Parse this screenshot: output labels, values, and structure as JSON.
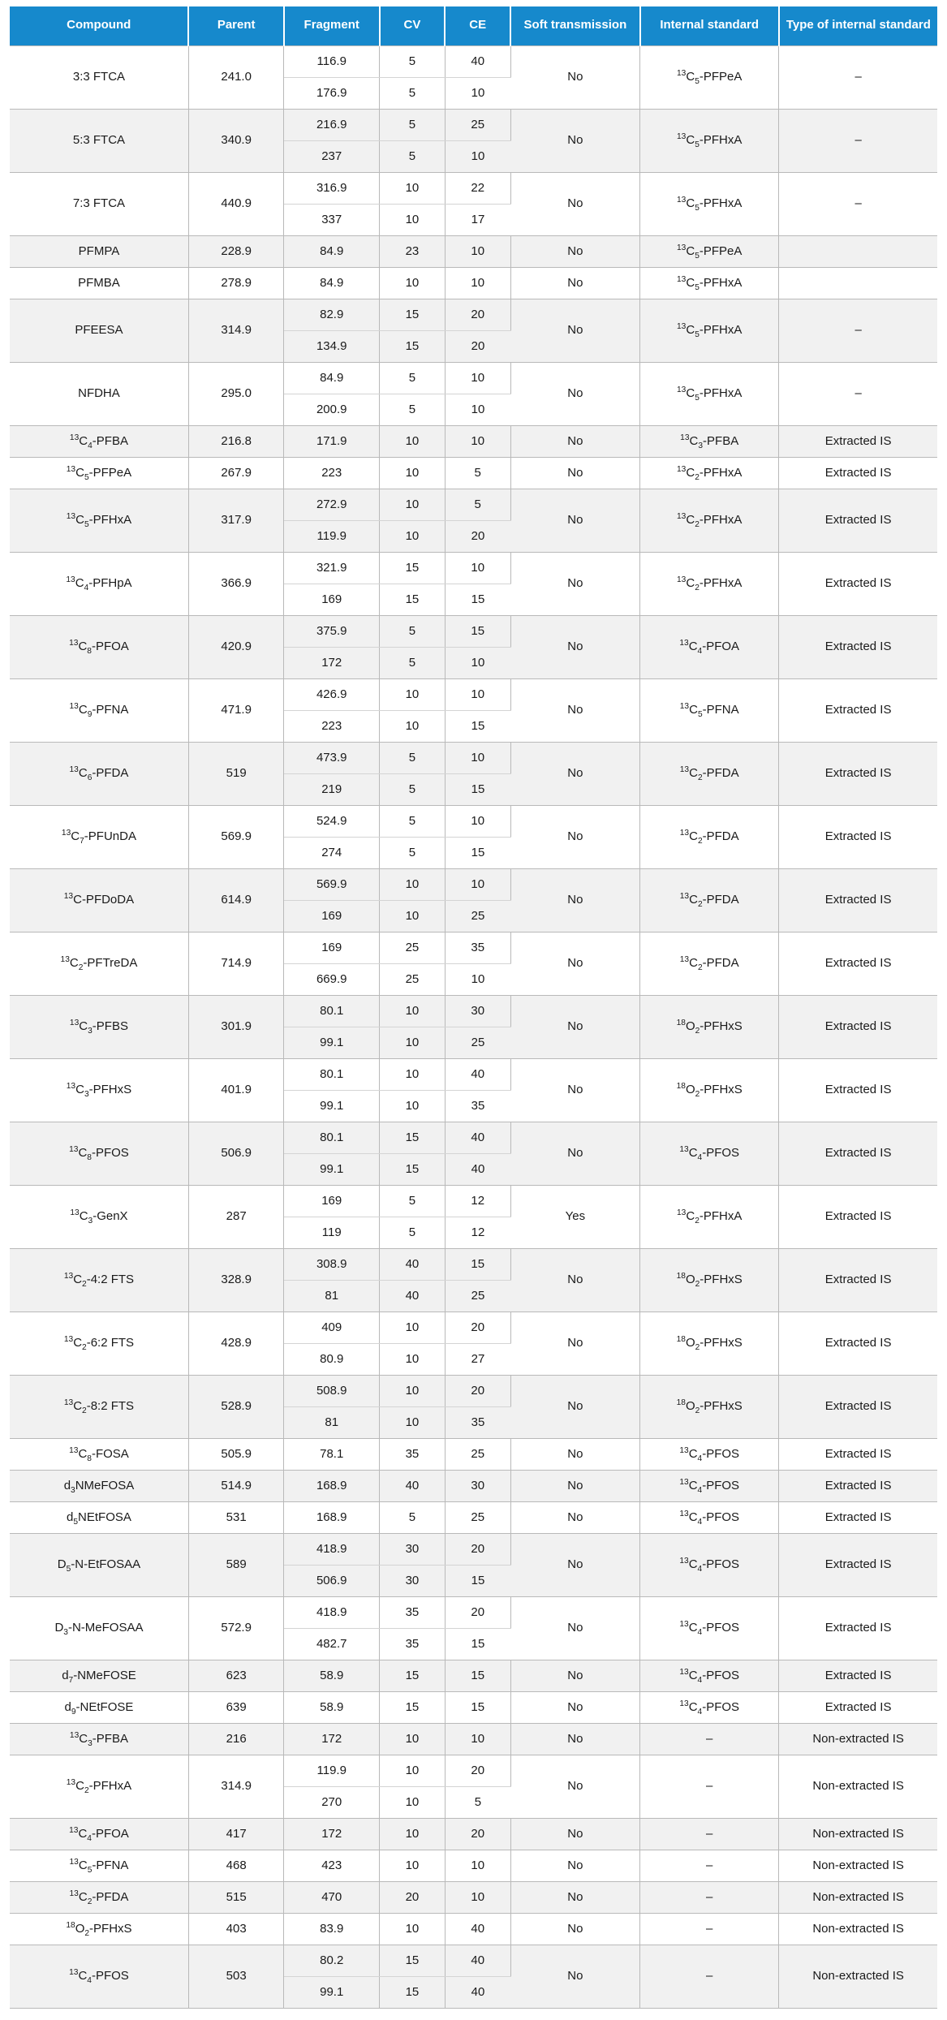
{
  "table": {
    "name": "MRM transition parameters table",
    "header_bg": "#1689cc",
    "header_text_color": "#ffffff",
    "stripe_color": "#f1f1f1",
    "columns": [
      {
        "key": "compound",
        "label": "Compound"
      },
      {
        "key": "parent",
        "label": "Parent"
      },
      {
        "key": "fragment",
        "label": "Fragment"
      },
      {
        "key": "cv",
        "label": "CV"
      },
      {
        "key": "ce",
        "label": "CE"
      },
      {
        "key": "soft",
        "label": "Soft transmission"
      },
      {
        "key": "istd",
        "label": "Internal standard"
      },
      {
        "key": "type",
        "label": "Type of internal standard"
      }
    ],
    "rows": [
      {
        "compound": "3:3 FTCA",
        "parent": "241.0",
        "transitions": [
          {
            "fragment": "116.9",
            "cv": "5",
            "ce": "40"
          },
          {
            "fragment": "176.9",
            "cv": "5",
            "ce": "10"
          }
        ],
        "soft": "No",
        "istd": "13C5-PFPeA",
        "type": "–"
      },
      {
        "compound": "5:3 FTCA",
        "parent": "340.9",
        "transitions": [
          {
            "fragment": "216.9",
            "cv": "5",
            "ce": "25"
          },
          {
            "fragment": "237",
            "cv": "5",
            "ce": "10"
          }
        ],
        "soft": "No",
        "istd": "13C5-PFHxA",
        "type": "–"
      },
      {
        "compound": "7:3 FTCA",
        "parent": "440.9",
        "transitions": [
          {
            "fragment": "316.9",
            "cv": "10",
            "ce": "22"
          },
          {
            "fragment": "337",
            "cv": "10",
            "ce": "17"
          }
        ],
        "soft": "No",
        "istd": "13C5-PFHxA",
        "type": "–"
      },
      {
        "compound": "PFMPA",
        "parent": "228.9",
        "transitions": [
          {
            "fragment": "84.9",
            "cv": "23",
            "ce": "10"
          }
        ],
        "soft": "No",
        "istd": "13C5-PFPeA",
        "type": ""
      },
      {
        "compound": "PFMBA",
        "parent": "278.9",
        "transitions": [
          {
            "fragment": "84.9",
            "cv": "10",
            "ce": "10"
          }
        ],
        "soft": "No",
        "istd": "13C5-PFHxA",
        "type": ""
      },
      {
        "compound": "PFEESA",
        "parent": "314.9",
        "transitions": [
          {
            "fragment": "82.9",
            "cv": "15",
            "ce": "20"
          },
          {
            "fragment": "134.9",
            "cv": "15",
            "ce": "20"
          }
        ],
        "soft": "No",
        "istd": "13C5-PFHxA",
        "type": "–"
      },
      {
        "compound": "NFDHA",
        "parent": "295.0",
        "transitions": [
          {
            "fragment": "84.9",
            "cv": "5",
            "ce": "10"
          },
          {
            "fragment": "200.9",
            "cv": "5",
            "ce": "10"
          }
        ],
        "soft": "No",
        "istd": "13C5-PFHxA",
        "type": "–"
      },
      {
        "compound": "13C4-PFBA",
        "parent": "216.8",
        "transitions": [
          {
            "fragment": "171.9",
            "cv": "10",
            "ce": "10"
          }
        ],
        "soft": "No",
        "istd": "13C3-PFBA",
        "type": "Extracted IS"
      },
      {
        "compound": "13C5-PFPeA",
        "parent": "267.9",
        "transitions": [
          {
            "fragment": "223",
            "cv": "10",
            "ce": "5"
          }
        ],
        "soft": "No",
        "istd": "13C2-PFHxA",
        "type": "Extracted IS"
      },
      {
        "compound": "13C5-PFHxA",
        "parent": "317.9",
        "transitions": [
          {
            "fragment": "272.9",
            "cv": "10",
            "ce": "5"
          },
          {
            "fragment": "119.9",
            "cv": "10",
            "ce": "20"
          }
        ],
        "soft": "No",
        "istd": "13C2-PFHxA",
        "type": "Extracted IS"
      },
      {
        "compound": "13C4-PFHpA",
        "parent": "366.9",
        "transitions": [
          {
            "fragment": "321.9",
            "cv": "15",
            "ce": "10"
          },
          {
            "fragment": "169",
            "cv": "15",
            "ce": "15"
          }
        ],
        "soft": "No",
        "istd": "13C2-PFHxA",
        "type": "Extracted IS"
      },
      {
        "compound": "13C8-PFOA",
        "parent": "420.9",
        "transitions": [
          {
            "fragment": "375.9",
            "cv": "5",
            "ce": "15"
          },
          {
            "fragment": "172",
            "cv": "5",
            "ce": "10"
          }
        ],
        "soft": "No",
        "istd": "13C4-PFOA",
        "type": "Extracted IS"
      },
      {
        "compound": "13C9-PFNA",
        "parent": "471.9",
        "transitions": [
          {
            "fragment": "426.9",
            "cv": "10",
            "ce": "10"
          },
          {
            "fragment": "223",
            "cv": "10",
            "ce": "15"
          }
        ],
        "soft": "No",
        "istd": "13C5-PFNA",
        "type": "Extracted IS"
      },
      {
        "compound": "13C6-PFDA",
        "parent": "519",
        "transitions": [
          {
            "fragment": "473.9",
            "cv": "5",
            "ce": "10"
          },
          {
            "fragment": "219",
            "cv": "5",
            "ce": "15"
          }
        ],
        "soft": "No",
        "istd": "13C2-PFDA",
        "type": "Extracted IS"
      },
      {
        "compound": "13C7-PFUnDA",
        "parent": "569.9",
        "transitions": [
          {
            "fragment": "524.9",
            "cv": "5",
            "ce": "10"
          },
          {
            "fragment": "274",
            "cv": "5",
            "ce": "15"
          }
        ],
        "soft": "No",
        "istd": "13C2-PFDA",
        "type": "Extracted IS"
      },
      {
        "compound": "13C-PFDoDA",
        "parent": "614.9",
        "transitions": [
          {
            "fragment": "569.9",
            "cv": "10",
            "ce": "10"
          },
          {
            "fragment": "169",
            "cv": "10",
            "ce": "25"
          }
        ],
        "soft": "No",
        "istd": "13C2-PFDA",
        "type": "Extracted IS"
      },
      {
        "compound": "13C2-PFTreDA",
        "parent": "714.9",
        "transitions": [
          {
            "fragment": "169",
            "cv": "25",
            "ce": "35"
          },
          {
            "fragment": "669.9",
            "cv": "25",
            "ce": "10"
          }
        ],
        "soft": "No",
        "istd": "13C2-PFDA",
        "type": "Extracted IS"
      },
      {
        "compound": "13C3-PFBS",
        "parent": "301.9",
        "transitions": [
          {
            "fragment": "80.1",
            "cv": "10",
            "ce": "30"
          },
          {
            "fragment": "99.1",
            "cv": "10",
            "ce": "25"
          }
        ],
        "soft": "No",
        "istd": "18O2-PFHxS",
        "type": "Extracted IS"
      },
      {
        "compound": "13C3-PFHxS",
        "parent": "401.9",
        "transitions": [
          {
            "fragment": "80.1",
            "cv": "10",
            "ce": "40"
          },
          {
            "fragment": "99.1",
            "cv": "10",
            "ce": "35"
          }
        ],
        "soft": "No",
        "istd": "18O2-PFHxS",
        "type": "Extracted IS"
      },
      {
        "compound": "13C8-PFOS",
        "parent": "506.9",
        "transitions": [
          {
            "fragment": "80.1",
            "cv": "15",
            "ce": "40"
          },
          {
            "fragment": "99.1",
            "cv": "15",
            "ce": "40"
          }
        ],
        "soft": "No",
        "istd": "13C4-PFOS",
        "type": "Extracted IS"
      },
      {
        "compound": "13C3-GenX",
        "parent": "287",
        "transitions": [
          {
            "fragment": "169",
            "cv": "5",
            "ce": "12"
          },
          {
            "fragment": "119",
            "cv": "5",
            "ce": "12"
          }
        ],
        "soft": "Yes",
        "istd": "13C2-PFHxA",
        "type": "Extracted IS"
      },
      {
        "compound": "13C2-4:2 FTS",
        "parent": "328.9",
        "transitions": [
          {
            "fragment": "308.9",
            "cv": "40",
            "ce": "15"
          },
          {
            "fragment": "81",
            "cv": "40",
            "ce": "25"
          }
        ],
        "soft": "No",
        "istd": "18O2-PFHxS",
        "type": "Extracted IS"
      },
      {
        "compound": "13C2-6:2 FTS",
        "parent": "428.9",
        "transitions": [
          {
            "fragment": "409",
            "cv": "10",
            "ce": "20"
          },
          {
            "fragment": "80.9",
            "cv": "10",
            "ce": "27"
          }
        ],
        "soft": "No",
        "istd": "18O2-PFHxS",
        "type": "Extracted IS"
      },
      {
        "compound": "13C2-8:2 FTS",
        "parent": "528.9",
        "transitions": [
          {
            "fragment": "508.9",
            "cv": "10",
            "ce": "20"
          },
          {
            "fragment": "81",
            "cv": "10",
            "ce": "35"
          }
        ],
        "soft": "No",
        "istd": "18O2-PFHxS",
        "type": "Extracted IS"
      },
      {
        "compound": "13C8-FOSA",
        "parent": "505.9",
        "transitions": [
          {
            "fragment": "78.1",
            "cv": "35",
            "ce": "25"
          }
        ],
        "soft": "No",
        "istd": "13C4-PFOS",
        "type": "Extracted IS"
      },
      {
        "compound": "d3NMeFOSA",
        "parent": "514.9",
        "transitions": [
          {
            "fragment": "168.9",
            "cv": "40",
            "ce": "30"
          }
        ],
        "soft": "No",
        "istd": "13C4-PFOS",
        "type": "Extracted IS"
      },
      {
        "compound": "d5NEtFOSA",
        "parent": "531",
        "transitions": [
          {
            "fragment": "168.9",
            "cv": "5",
            "ce": "25"
          }
        ],
        "soft": "No",
        "istd": "13C4-PFOS",
        "type": "Extracted IS"
      },
      {
        "compound": "D5-N-EtFOSAA",
        "parent": "589",
        "transitions": [
          {
            "fragment": "418.9",
            "cv": "30",
            "ce": "20"
          },
          {
            "fragment": "506.9",
            "cv": "30",
            "ce": "15"
          }
        ],
        "soft": "No",
        "istd": "13C4-PFOS",
        "type": "Extracted IS"
      },
      {
        "compound": "D3-N-MeFOSAA",
        "parent": "572.9",
        "transitions": [
          {
            "fragment": "418.9",
            "cv": "35",
            "ce": "20"
          },
          {
            "fragment": "482.7",
            "cv": "35",
            "ce": "15"
          }
        ],
        "soft": "No",
        "istd": "13C4-PFOS",
        "type": "Extracted IS"
      },
      {
        "compound": "d7-NMeFOSE",
        "parent": "623",
        "transitions": [
          {
            "fragment": "58.9",
            "cv": "15",
            "ce": "15"
          }
        ],
        "soft": "No",
        "istd": "13C4-PFOS",
        "type": "Extracted IS"
      },
      {
        "compound": "d9-NEtFOSE",
        "parent": "639",
        "transitions": [
          {
            "fragment": "58.9",
            "cv": "15",
            "ce": "15"
          }
        ],
        "soft": "No",
        "istd": "13C4-PFOS",
        "type": "Extracted IS"
      },
      {
        "compound": "13C3-PFBA",
        "parent": "216",
        "transitions": [
          {
            "fragment": "172",
            "cv": "10",
            "ce": "10"
          }
        ],
        "soft": "No",
        "istd": "–",
        "type": "Non-extracted IS"
      },
      {
        "compound": "13C2-PFHxA",
        "parent": "314.9",
        "transitions": [
          {
            "fragment": "119.9",
            "cv": "10",
            "ce": "20"
          },
          {
            "fragment": "270",
            "cv": "10",
            "ce": "5"
          }
        ],
        "soft": "No",
        "istd": "–",
        "type": "Non-extracted IS"
      },
      {
        "compound": "13C4-PFOA",
        "parent": "417",
        "transitions": [
          {
            "fragment": "172",
            "cv": "10",
            "ce": "20"
          }
        ],
        "soft": "No",
        "istd": "–",
        "type": "Non-extracted IS"
      },
      {
        "compound": "13C5-PFNA",
        "parent": "468",
        "transitions": [
          {
            "fragment": "423",
            "cv": "10",
            "ce": "10"
          }
        ],
        "soft": "No",
        "istd": "–",
        "type": "Non-extracted IS"
      },
      {
        "compound": "13C2-PFDA",
        "parent": "515",
        "transitions": [
          {
            "fragment": "470",
            "cv": "20",
            "ce": "10"
          }
        ],
        "soft": "No",
        "istd": "–",
        "type": "Non-extracted IS"
      },
      {
        "compound": "18O2-PFHxS",
        "parent": "403",
        "transitions": [
          {
            "fragment": "83.9",
            "cv": "10",
            "ce": "40"
          }
        ],
        "soft": "No",
        "istd": "–",
        "type": "Non-extracted IS"
      },
      {
        "compound": "13C4-PFOS",
        "parent": "503",
        "transitions": [
          {
            "fragment": "80.2",
            "cv": "15",
            "ce": "40"
          },
          {
            "fragment": "99.1",
            "cv": "15",
            "ce": "40"
          }
        ],
        "soft": "No",
        "istd": "–",
        "type": "Non-extracted IS"
      }
    ]
  }
}
